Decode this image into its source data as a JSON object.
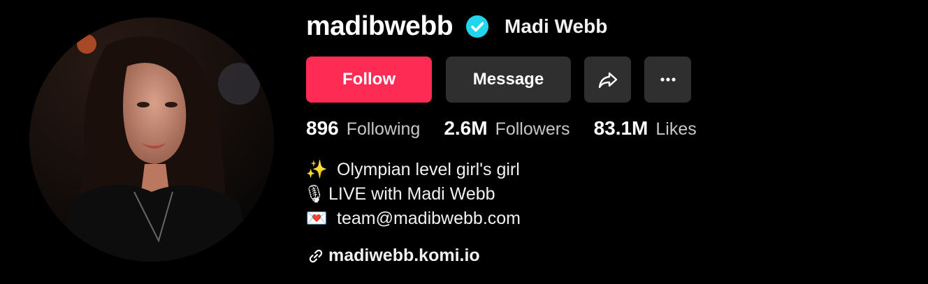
{
  "profile": {
    "username": "madibwebb",
    "nickname": "Madi Webb",
    "verified": true,
    "accent_color": "#fe2c55",
    "verified_color": "#20d5ec"
  },
  "buttons": {
    "follow_label": "Follow",
    "message_label": "Message",
    "share_icon": "share-icon",
    "more_icon": "more-icon"
  },
  "stats": [
    {
      "value": "896",
      "label": "Following"
    },
    {
      "value": "2.6M",
      "label": "Followers"
    },
    {
      "value": "83.1M",
      "label": "Likes"
    }
  ],
  "bio": [
    {
      "emoji": "✨",
      "text": "Olympian level girl's girl"
    },
    {
      "emoji": "🎙",
      "text": "LIVE with Madi Webb"
    },
    {
      "emoji": "💌",
      "text": "team@madibwebb.com"
    }
  ],
  "link": {
    "icon": "link-icon",
    "text": "madiwebb.komi.io"
  }
}
